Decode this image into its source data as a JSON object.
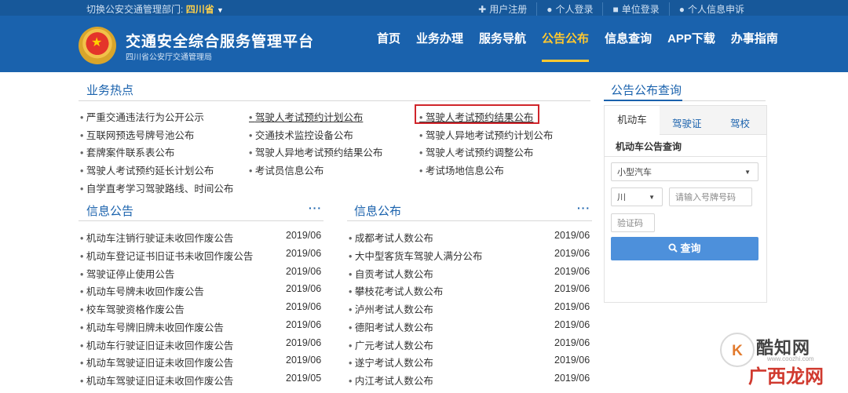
{
  "topbar": {
    "switch_label": "切换公安交通管理部门:",
    "province": "四川省",
    "links": [
      {
        "icon": "plus-icon",
        "label": "用户注册"
      },
      {
        "icon": "user-icon",
        "label": "个人登录"
      },
      {
        "icon": "building-icon",
        "label": "单位登录"
      },
      {
        "icon": "person-icon",
        "label": "个人信息申诉"
      }
    ]
  },
  "header": {
    "title": "交通安全综合服务管理平台",
    "subtitle": "四川省公安厅交通管理局",
    "nav": [
      "首页",
      "业务办理",
      "服务导航",
      "公告公布",
      "信息查询",
      "APP下载",
      "办事指南"
    ],
    "active_nav": "公告公布"
  },
  "hot": {
    "title": "业务热点",
    "col1": [
      "严重交通违法行为公开公示",
      "互联网预选号牌号池公布",
      "套牌案件联系表公布",
      "驾驶人考试预约延长计划公布",
      "自学直考学习驾驶路线、时间公布"
    ],
    "col2": [
      "驾驶人考试预约计划公布",
      "交通技术监控设备公布",
      "驾驶人异地考试预约结果公布",
      "考试员信息公布"
    ],
    "col3": [
      "驾驶人考试预约结果公布",
      "驾驶人异地考试预约计划公布",
      "驾驶人考试预约调整公布",
      "考试场地信息公布"
    ]
  },
  "info_notice": {
    "title": "信息公告",
    "more": "···",
    "items": [
      {
        "text": "机动车注销行驶证未收回作废公告",
        "date": "2019/06"
      },
      {
        "text": "机动车登记证书旧证书未收回作废公告",
        "date": "2019/06"
      },
      {
        "text": "驾驶证停止使用公告",
        "date": "2019/06"
      },
      {
        "text": "机动车号牌未收回作废公告",
        "date": "2019/06"
      },
      {
        "text": "校车驾驶资格作废公告",
        "date": "2019/06"
      },
      {
        "text": "机动车号牌旧牌未收回作废公告",
        "date": "2019/06"
      },
      {
        "text": "机动车行驶证旧证未收回作废公告",
        "date": "2019/06"
      },
      {
        "text": "机动车驾驶证旧证未收回作废公告",
        "date": "2019/06"
      },
      {
        "text": "机动车驾驶证旧证未收回作废公告",
        "date": "2019/05"
      }
    ]
  },
  "info_publish": {
    "title": "信息公布",
    "more": "···",
    "items": [
      {
        "text": "成都考试人数公布",
        "date": "2019/06"
      },
      {
        "text": "大中型客货车驾驶人满分公布",
        "date": "2019/06"
      },
      {
        "text": "自贡考试人数公布",
        "date": "2019/06"
      },
      {
        "text": "攀枝花考试人数公布",
        "date": "2019/06"
      },
      {
        "text": "泸州考试人数公布",
        "date": "2019/06"
      },
      {
        "text": "德阳考试人数公布",
        "date": "2019/06"
      },
      {
        "text": "广元考试人数公布",
        "date": "2019/06"
      },
      {
        "text": "遂宁考试人数公布",
        "date": "2019/06"
      },
      {
        "text": "内江考试人数公布",
        "date": "2019/06"
      }
    ]
  },
  "query": {
    "title": "公告公布查询",
    "tabs": [
      "机动车",
      "驾驶证",
      "驾校"
    ],
    "subtitle": "机动车公告查询",
    "vehicle_type": "小型汽车",
    "province_abbr": "川",
    "plate_placeholder": "请输入号牌号码",
    "captcha_placeholder": "验证码",
    "button": "查询"
  },
  "watermark": {
    "logo": "K",
    "name": "酷知网",
    "url": "www.coozhi.com",
    "sub": "广西龙网"
  }
}
